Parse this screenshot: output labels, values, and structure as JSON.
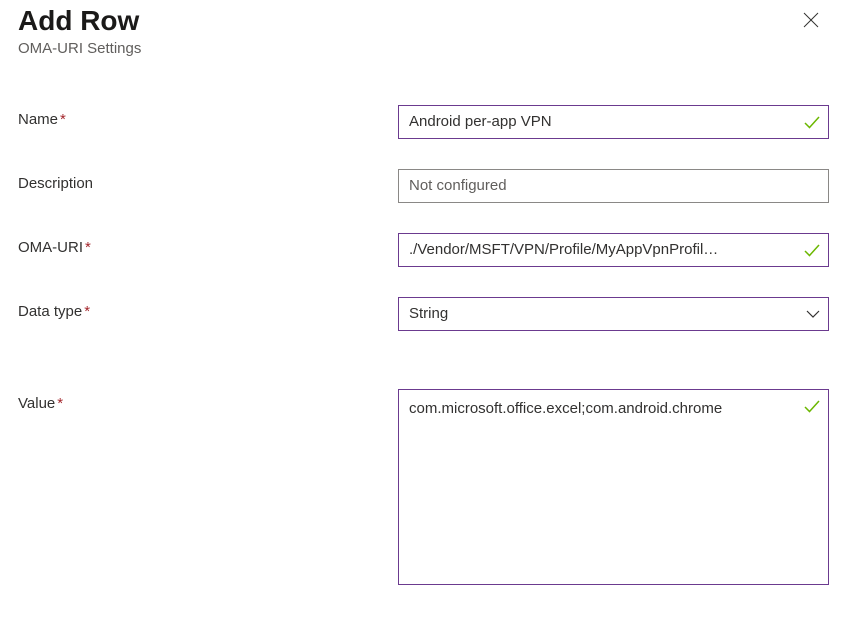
{
  "header": {
    "title": "Add Row",
    "subtitle": "OMA-URI Settings"
  },
  "form": {
    "name": {
      "label": "Name",
      "required": "*",
      "value": "Android per-app VPN"
    },
    "description": {
      "label": "Description",
      "placeholder": "Not configured",
      "value": ""
    },
    "oma_uri": {
      "label": "OMA-URI",
      "required": "*",
      "value": "./Vendor/MSFT/VPN/Profile/MyAppVpnProfil…"
    },
    "data_type": {
      "label": "Data type",
      "required": "*",
      "selected": "String"
    },
    "value": {
      "label": "Value",
      "required": "*",
      "value": "com.microsoft.office.excel;com.android.chrome"
    }
  },
  "colors": {
    "accent": "#6b3a8f",
    "success": "#6bb700",
    "required": "#a4262c"
  }
}
